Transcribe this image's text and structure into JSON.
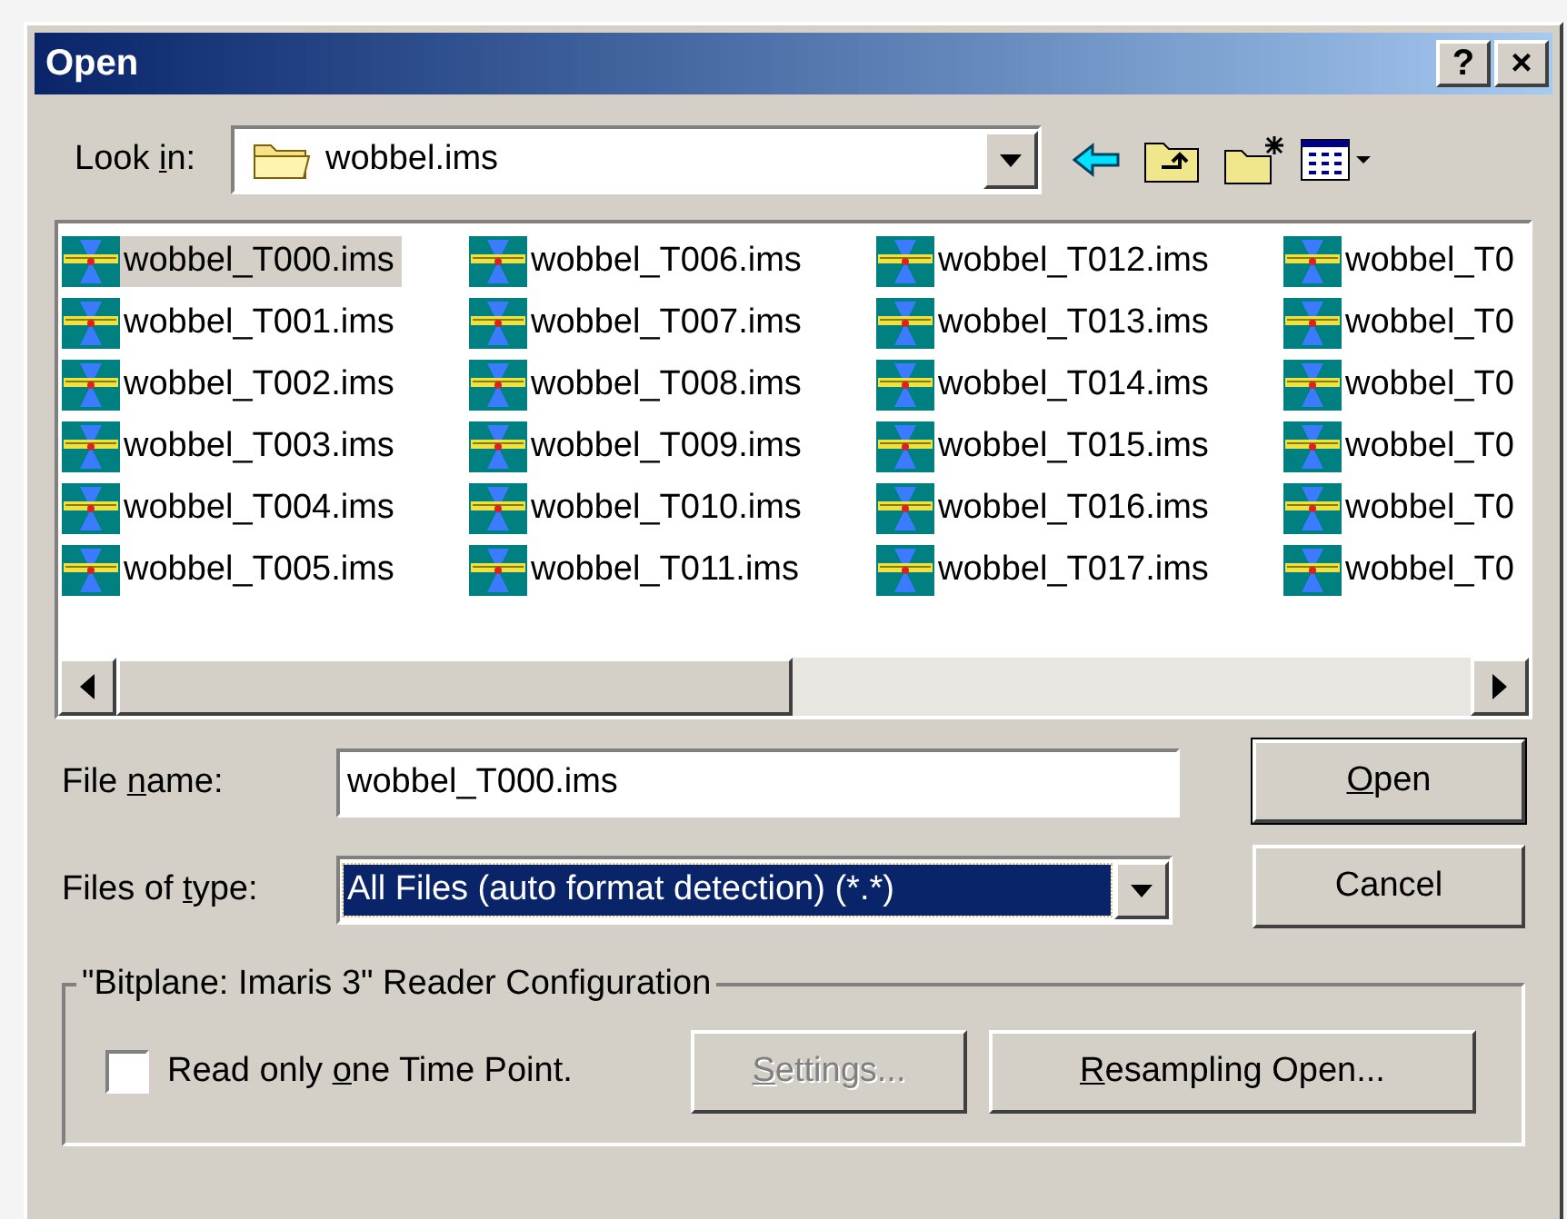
{
  "window": {
    "title": "Open",
    "buttons": [
      "?",
      "×"
    ]
  },
  "look_in": {
    "label": {
      "before": "Look ",
      "key": "i",
      "after": "n:"
    },
    "value": "wobbel.ims"
  },
  "files": [
    {
      "name": "wobbel_T000.ims",
      "selected": true
    },
    {
      "name": "wobbel_T001.ims",
      "selected": false
    },
    {
      "name": "wobbel_T002.ims",
      "selected": false
    },
    {
      "name": "wobbel_T003.ims",
      "selected": false
    },
    {
      "name": "wobbel_T004.ims",
      "selected": false
    },
    {
      "name": "wobbel_T005.ims",
      "selected": false
    },
    {
      "name": "wobbel_T006.ims",
      "selected": false
    },
    {
      "name": "wobbel_T007.ims",
      "selected": false
    },
    {
      "name": "wobbel_T008.ims",
      "selected": false
    },
    {
      "name": "wobbel_T009.ims",
      "selected": false
    },
    {
      "name": "wobbel_T010.ims",
      "selected": false
    },
    {
      "name": "wobbel_T011.ims",
      "selected": false
    },
    {
      "name": "wobbel_T012.ims",
      "selected": false
    },
    {
      "name": "wobbel_T013.ims",
      "selected": false
    },
    {
      "name": "wobbel_T014.ims",
      "selected": false
    },
    {
      "name": "wobbel_T015.ims",
      "selected": false
    },
    {
      "name": "wobbel_T016.ims",
      "selected": false
    },
    {
      "name": "wobbel_T017.ims",
      "selected": false
    },
    {
      "name": "wobbel_T0",
      "selected": false
    },
    {
      "name": "wobbel_T0",
      "selected": false
    },
    {
      "name": "wobbel_T0",
      "selected": false
    },
    {
      "name": "wobbel_T0",
      "selected": false
    },
    {
      "name": "wobbel_T0",
      "selected": false
    },
    {
      "name": "wobbel_T0",
      "selected": false
    }
  ],
  "file_name": {
    "label": {
      "before": "File ",
      "key": "n",
      "after": "ame:"
    },
    "value": "wobbel_T000.ims"
  },
  "file_type": {
    "label": {
      "before": "Files of ",
      "key": "t",
      "after": "ype:"
    },
    "value": "All Files (auto format detection) (*.*)",
    "focused": true
  },
  "buttons": [
    {
      "key": "O",
      "after": "pen"
    },
    {
      "before": "Cancel"
    }
  ],
  "reader_group": {
    "title": "\"Bitplane: Imaris 3\" Reader Configuration",
    "checkbox": {
      "label": {
        "before": "Read only ",
        "key": "o",
        "after": "ne Time Point."
      },
      "checked": false
    },
    "buttons": [
      {
        "label": {
          "key": "S",
          "after": "ettings..."
        },
        "disabled": true
      },
      {
        "label": {
          "key": "R",
          "after": "esampling Open..."
        },
        "disabled": false
      }
    ]
  }
}
